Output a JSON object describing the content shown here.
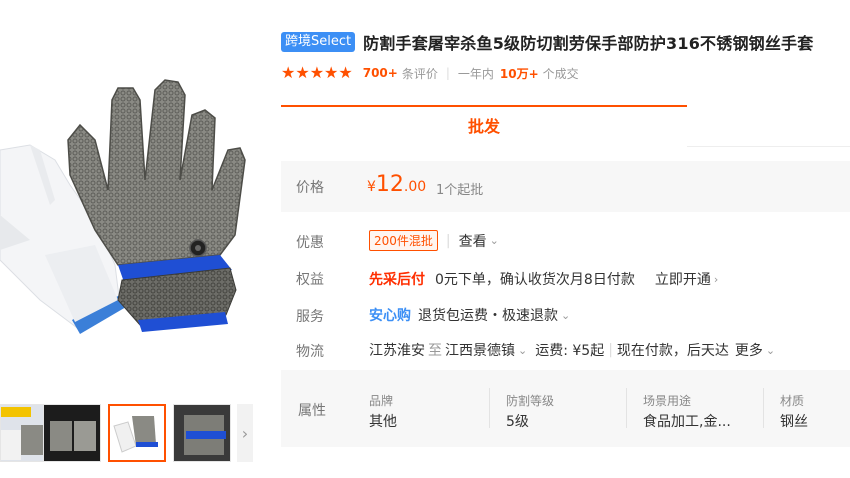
{
  "product": {
    "badge": "跨境Select",
    "title": "防割手套屠宰杀鱼5级防切割劳保手部防护316不锈钢钢丝手套"
  },
  "rating": {
    "stars": 5,
    "review_count": "700+",
    "review_label": "条评价",
    "year_label": "一年内",
    "sales": "10万+",
    "sales_label": "个成交"
  },
  "tabs": {
    "active": "批发"
  },
  "price": {
    "label": "价格",
    "currency": "¥",
    "integer": "12",
    "decimal": ".00",
    "moq": "1个起批"
  },
  "discount": {
    "label": "优惠",
    "tag": "200件混批",
    "link": "查看"
  },
  "benefits": {
    "label": "权益",
    "highlight": "先采后付",
    "desc": "0元下单，确认收货次月8日付款",
    "action": "立即开通"
  },
  "service": {
    "label": "服务",
    "highlight": "安心购",
    "desc": "退货包运费・极速退款"
  },
  "logistics": {
    "label": "物流",
    "from": "江苏淮安",
    "to_word": "至",
    "to": "江西景德镇",
    "fee": "运费: ¥5起",
    "pay": "现在付款，后天达",
    "more": "更多"
  },
  "attributes": {
    "label": "属性",
    "items": [
      {
        "key": "品牌",
        "value": "其他"
      },
      {
        "key": "防割等级",
        "value": "5级"
      },
      {
        "key": "场景用途",
        "value": "食品加工,金..."
      },
      {
        "key": "材质",
        "value": "钢丝"
      }
    ]
  },
  "colors": {
    "accent": "#ff5000",
    "badge": "#3c8ff5",
    "highlight_red": "#ff2e00"
  }
}
